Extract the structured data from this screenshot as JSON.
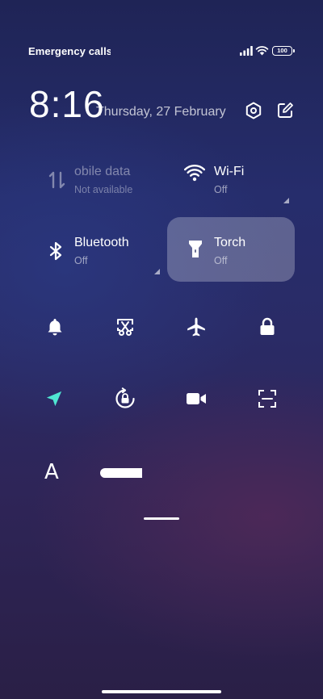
{
  "status_bar": {
    "carrier_text": "Emergency calls o",
    "battery_level": "100"
  },
  "header": {
    "time": "8:16",
    "date": "Thursday, 27 February"
  },
  "tiles": [
    {
      "id": "mobile-data",
      "title": "obile data",
      "subtitle": "Not available",
      "state": "disabled"
    },
    {
      "id": "wifi",
      "title": "Wi-Fi",
      "subtitle": "Off",
      "state": "off"
    },
    {
      "id": "bluetooth",
      "title": "Bluetooth",
      "subtitle": "Off",
      "state": "off"
    },
    {
      "id": "torch",
      "title": "Torch",
      "subtitle": "Off",
      "state": "active"
    }
  ],
  "toggles_row1": [
    "bell-icon",
    "scissors-screenshot-icon",
    "airplane-icon",
    "lock-icon"
  ],
  "toggles_row2": [
    "location-icon",
    "rotation-lock-icon",
    "video-camera-icon",
    "scan-icon"
  ],
  "font_toggle": {
    "label": "A"
  },
  "colors": {
    "accent_location": "#4fe6d2",
    "active_tile": "#5a5f86"
  }
}
